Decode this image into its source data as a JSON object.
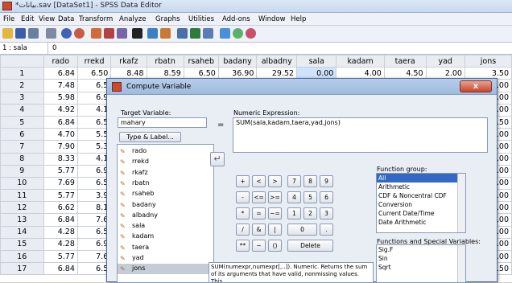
{
  "window": {
    "title": "*بيانات.sav [DataSet1] - SPSS Data Editor"
  },
  "menu": [
    "File",
    "Edit",
    "View",
    "Data",
    "Transform",
    "Analyze",
    "Graphs",
    "Utilities",
    "Add-ons",
    "Window",
    "Help"
  ],
  "cell_editor": {
    "name": "1 : sala",
    "value": "0"
  },
  "grid": {
    "columns": [
      "rado",
      "rrekd",
      "rkafz",
      "rbatn",
      "rsaheb",
      "badany",
      "albadny",
      "sala",
      "kadam",
      "taera",
      "yad",
      "jons"
    ],
    "rows": [
      {
        "n": "1",
        "rado": "6.84",
        "rrekd": "6.50",
        "rkafz": "8.48",
        "rbatn": "8.59",
        "rsaheb": "6.50",
        "badany": "36.90",
        "albadny": "29.52",
        "sala": "0.00",
        "kadam": "4.00",
        "taera": "4.50",
        "yad": "2.00",
        "jons": "3.50"
      },
      {
        "n": "2",
        "rado": "7.48",
        "rrekd": "6.5",
        "jons": "3.00"
      },
      {
        "n": "3",
        "rado": "5.98",
        "rrekd": "6.9",
        "jons": "4.00"
      },
      {
        "n": "4",
        "rado": "4.92",
        "rrekd": "4.1",
        "jons": "3.00"
      },
      {
        "n": "5",
        "rado": "6.84",
        "rrekd": "6.5",
        "jons": "3.50"
      },
      {
        "n": "6",
        "rado": "4.70",
        "rrekd": "5.5",
        "jons": "4.00"
      },
      {
        "n": "7",
        "rado": "7.90",
        "rrekd": "5.3",
        "jons": "4.00"
      },
      {
        "n": "8",
        "rado": "8.33",
        "rrekd": "4.1",
        "jons": "3.00"
      },
      {
        "n": "9",
        "rado": "5.77",
        "rrekd": "6.9",
        "jons": "3.00"
      },
      {
        "n": "10",
        "rado": "7.69",
        "rrekd": "6.5",
        "jons": "4.00"
      },
      {
        "n": "11",
        "rado": "5.77",
        "rrekd": "3.9",
        "jons": "4.00"
      },
      {
        "n": "12",
        "rado": "6.62",
        "rrekd": "8.1",
        "jons": "4.00"
      },
      {
        "n": "13",
        "rado": "6.84",
        "rrekd": "7.6",
        "jons": "0.00"
      },
      {
        "n": "14",
        "rado": "4.28",
        "rrekd": "6.5",
        "jons": "4.00"
      },
      {
        "n": "15",
        "rado": "4.28",
        "rrekd": "6.9",
        "jons": "3.00"
      },
      {
        "n": "16",
        "rado": "5.77",
        "rrekd": "7.6",
        "jons": "3.00"
      },
      {
        "n": "17",
        "rado": "6.84",
        "rrekd": "6.5",
        "jons": "3.50"
      }
    ]
  },
  "dialog": {
    "title": "Compute Variable",
    "close": "x",
    "target_label": "Target Variable:",
    "target_value": "mahary",
    "type_label_button": "Type & Label...",
    "equals": "=",
    "expr_label": "Numeric Expression:",
    "expr_value": "SUM(sala,kadam,taera,yad,jons)",
    "variables": [
      "rado",
      "rrekd",
      "rkafz",
      "rbatn",
      "rsaheb",
      "badany",
      "albadny",
      "sala",
      "kadam",
      "taera",
      "yad",
      "jons"
    ],
    "keypad": [
      [
        "+",
        "<",
        ">",
        "7",
        "8",
        "9"
      ],
      [
        "-",
        "<=",
        ">=",
        "4",
        "5",
        "6"
      ],
      [
        "*",
        "=",
        "~=",
        "1",
        "2",
        "3"
      ],
      [
        "/",
        "&",
        "|",
        "0",
        "."
      ],
      [
        "**",
        "~",
        "()",
        "Delete"
      ]
    ],
    "function_group_label": "Function group:",
    "function_groups": [
      "All",
      "Arithmetic",
      "CDF & Noncentral CDF",
      "Conversion",
      "Current Date/Time",
      "Date Arithmetic"
    ],
    "functions_label": "Functions and Special Variables:",
    "functions": [
      "Sig.F",
      "Sin",
      "Sqrt"
    ],
    "description": "SUM(numexpr,numexpr[,..]). Numeric. Returns the sum of its arguments that have valid, nonmissing values. This"
  }
}
